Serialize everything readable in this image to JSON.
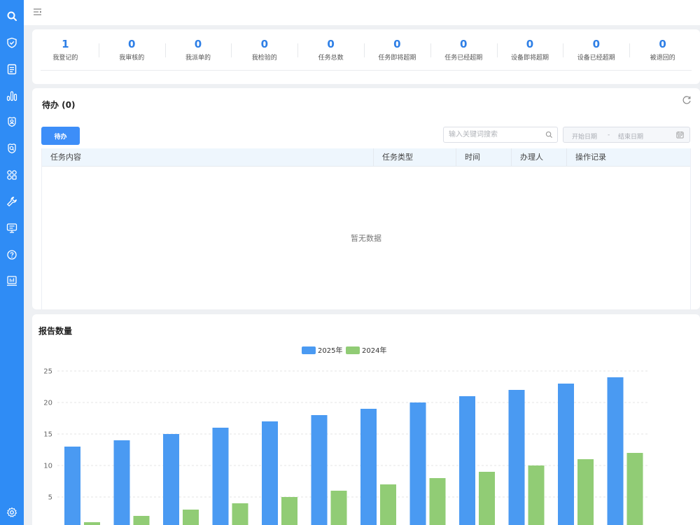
{
  "sidebar": {
    "color": "#2f8cf5",
    "icons": [
      "search-icon",
      "shield-check-icon",
      "document-icon",
      "bar-chart-icon",
      "badge-icon",
      "search-badge-icon",
      "apps-grid-icon",
      "wrench-icon",
      "monitor-icon",
      "help-icon",
      "report-chart-icon",
      "settings-gear-icon"
    ]
  },
  "topbar": {
    "menu_icon": "menu-fold-icon"
  },
  "stats": [
    {
      "value": "1",
      "label": "我登记的"
    },
    {
      "value": "0",
      "label": "我审核的"
    },
    {
      "value": "0",
      "label": "我派单的"
    },
    {
      "value": "0",
      "label": "我检验的"
    },
    {
      "value": "0",
      "label": "任务总数"
    },
    {
      "value": "0",
      "label": "任务即将超期"
    },
    {
      "value": "0",
      "label": "任务已经超期"
    },
    {
      "value": "0",
      "label": "设备即将超期"
    },
    {
      "value": "0",
      "label": "设备已经超期"
    },
    {
      "value": "0",
      "label": "被退回的"
    }
  ],
  "todo": {
    "title": "待办 (0)",
    "tab_label": "待办",
    "search_placeholder": "输入关键词搜索",
    "date_start_placeholder": "开始日期",
    "date_separator": "-",
    "date_end_placeholder": "结束日期",
    "columns": [
      "任务内容",
      "任务类型",
      "时间",
      "办理人",
      "操作记录"
    ],
    "empty_text": "暂无数据"
  },
  "report": {
    "title": "报告数量"
  },
  "chart_data": {
    "type": "bar",
    "ylim": [
      0,
      25
    ],
    "yticks": [
      "5",
      "10",
      "15",
      "20",
      "25"
    ],
    "grid": true,
    "legend_position": "top-center",
    "series": [
      {
        "name": "2025年",
        "color": "#4a9af2",
        "values": [
          13,
          14,
          15,
          16,
          17,
          18,
          19,
          20,
          21,
          22,
          23,
          24
        ]
      },
      {
        "name": "2024年",
        "color": "#91cc75",
        "values": [
          1,
          2,
          3,
          4,
          5,
          6,
          7,
          8,
          9,
          10,
          11,
          12
        ]
      }
    ]
  }
}
